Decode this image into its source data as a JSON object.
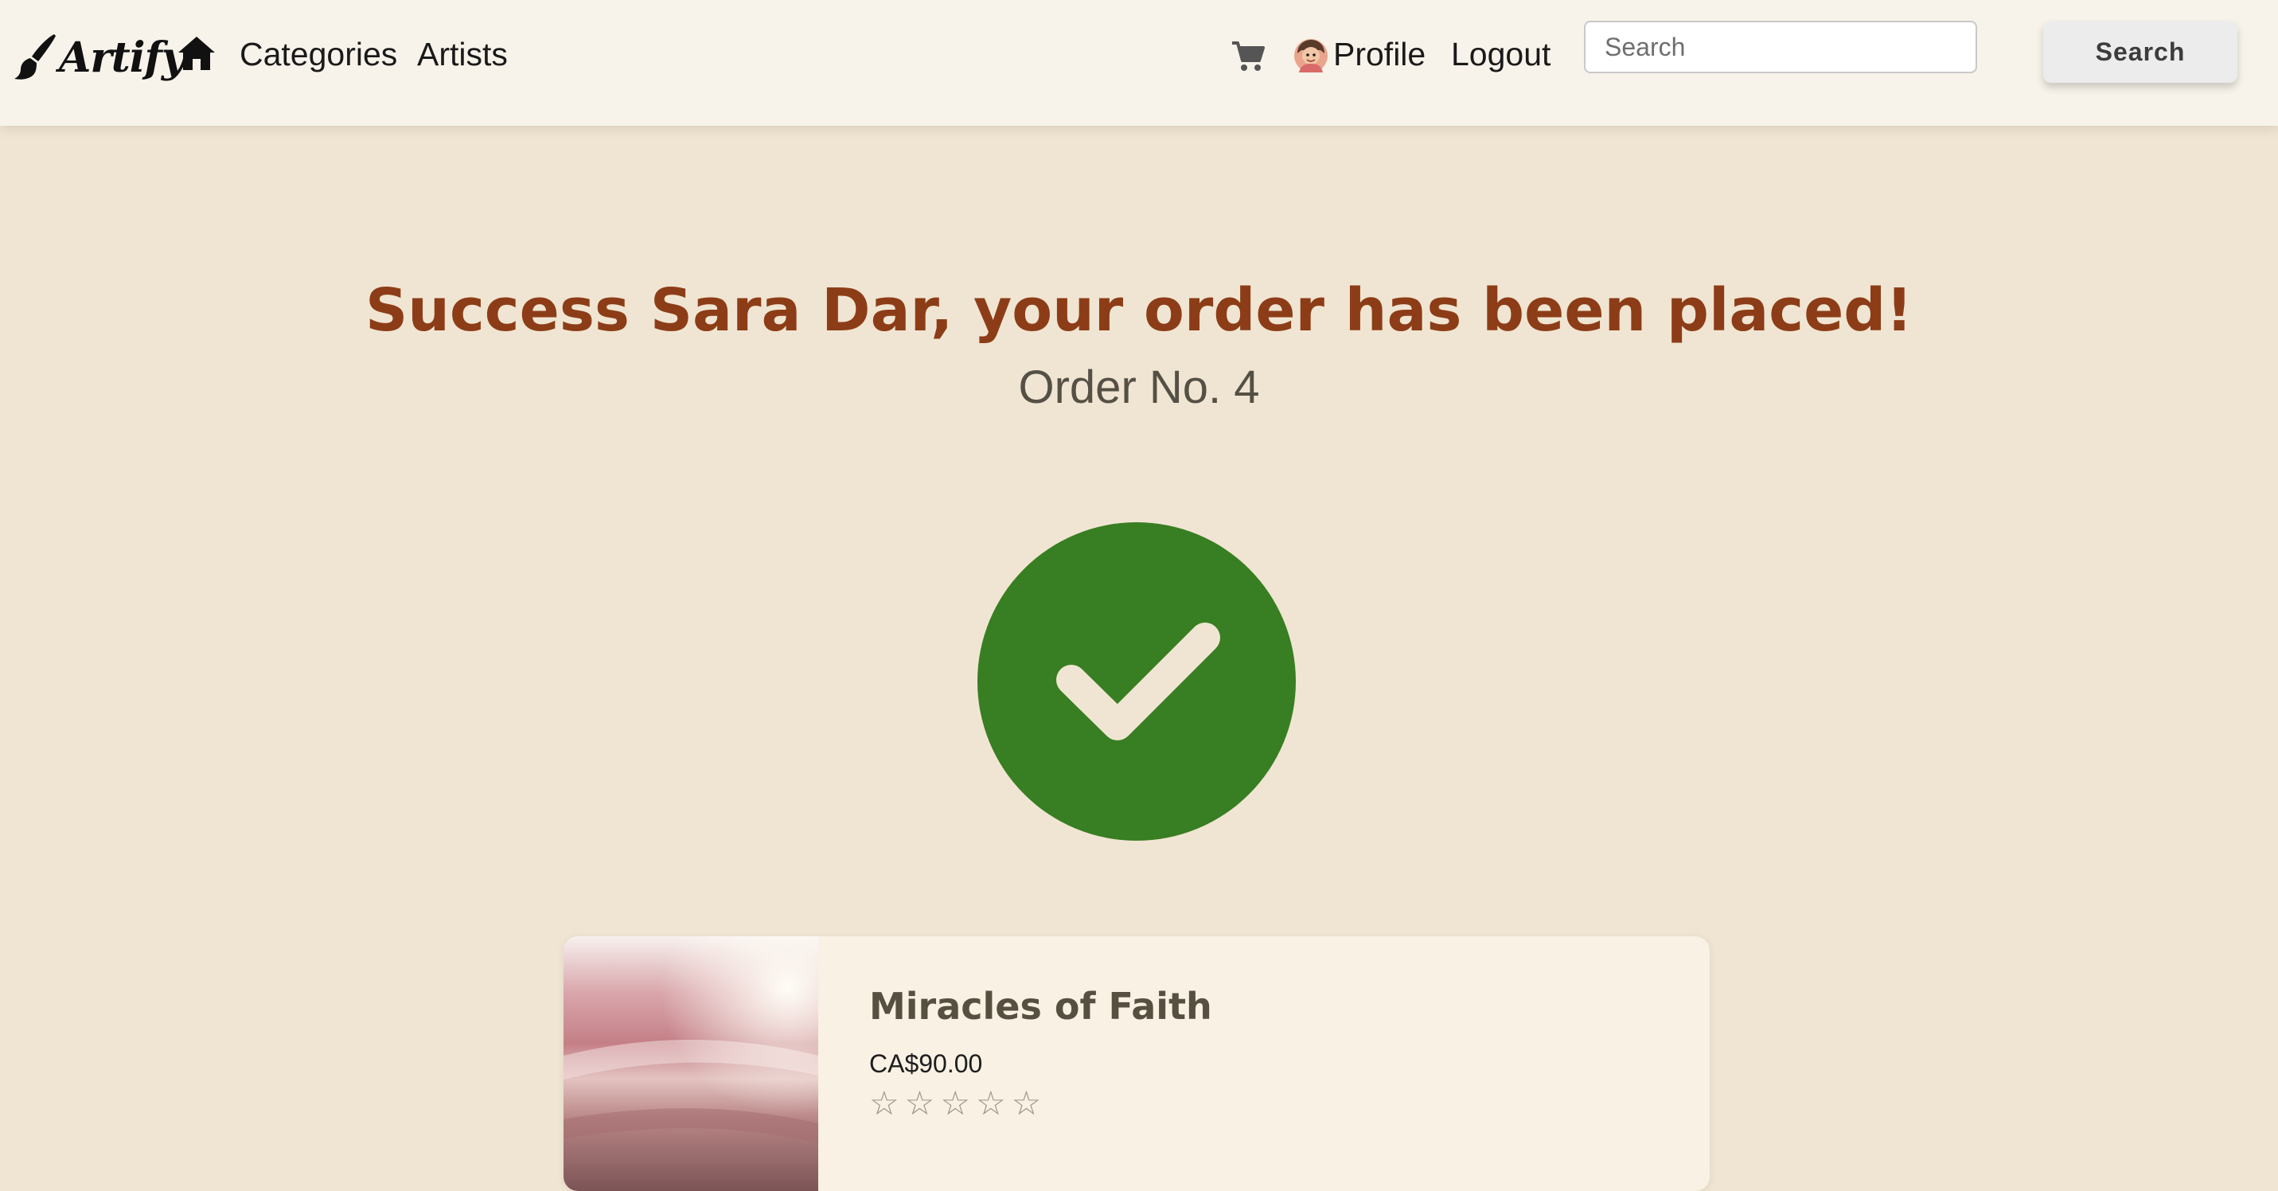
{
  "header": {
    "brand": "Artify",
    "nav": {
      "home_icon": "home-icon",
      "categories": "Categories",
      "artists": "Artists",
      "cart_icon": "cart-icon",
      "profile": "Profile",
      "logout": "Logout"
    },
    "search": {
      "placeholder": "Search",
      "value": "",
      "button_label": "Search"
    }
  },
  "main": {
    "title": "Success Sara Dar, your order has been placed!",
    "order_number": "Order No. 4",
    "status_icon": "check-circle-icon"
  },
  "order": {
    "items": [
      {
        "title": "Miracles of Faith",
        "price": "CA$90.00",
        "rating": 0,
        "rating_max": 5
      }
    ]
  },
  "colors": {
    "page_background": "#f0e5d2",
    "navbar_background": "#f8f3ea",
    "headline": "#8c3d17",
    "success_green": "#387e22",
    "card_background": "#f9f1e4"
  }
}
